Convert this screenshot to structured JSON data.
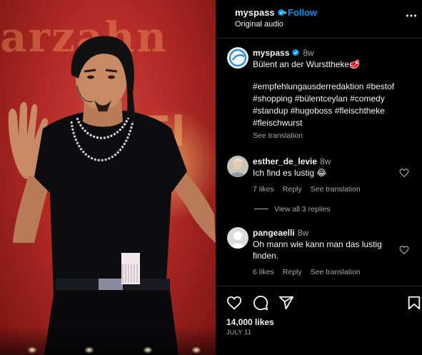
{
  "post": {
    "username": "myspass",
    "follow_label": "Follow",
    "separator": "•",
    "audio_label": "Original audio"
  },
  "caption": {
    "username": "myspass",
    "time": "8w",
    "title": "Bülent an der Wursttheke🥩",
    "hashtag_lines": [
      "#empfehlungausderredaktion #bestof",
      "#shopping #bülentceylan #comedy",
      "#standup #hugoboss #fleischtheke",
      "#fleischwurst"
    ],
    "see_translation": "See translation"
  },
  "comments": [
    {
      "username": "esther_de_levie",
      "time": "8w",
      "text": "Ich find es lustig 😂",
      "likes": "7 likes",
      "reply": "Reply",
      "see_translation": "See translation",
      "view_replies": "View all 3 replies"
    },
    {
      "username": "pangeaelli",
      "time": "8w",
      "text_lines": [
        "Oh mann wie kann man das lustig",
        "finden."
      ],
      "likes": "6 likes",
      "reply": "Reply",
      "see_translation": "See translation"
    }
  ],
  "actions": {
    "likes_count": "14,000 likes",
    "date": "JULY 11"
  },
  "media": {
    "sign_text": "arzahn",
    "sign_text_2": "Fl"
  },
  "colors": {
    "background": "#000000",
    "follow_blue": "#0095f6",
    "muted_text": "#a8a8a8",
    "divider": "#262626"
  },
  "icons": [
    "verified-badge-icon",
    "more-options-icon",
    "heart-icon",
    "comment-icon",
    "share-icon",
    "bookmark-icon"
  ]
}
